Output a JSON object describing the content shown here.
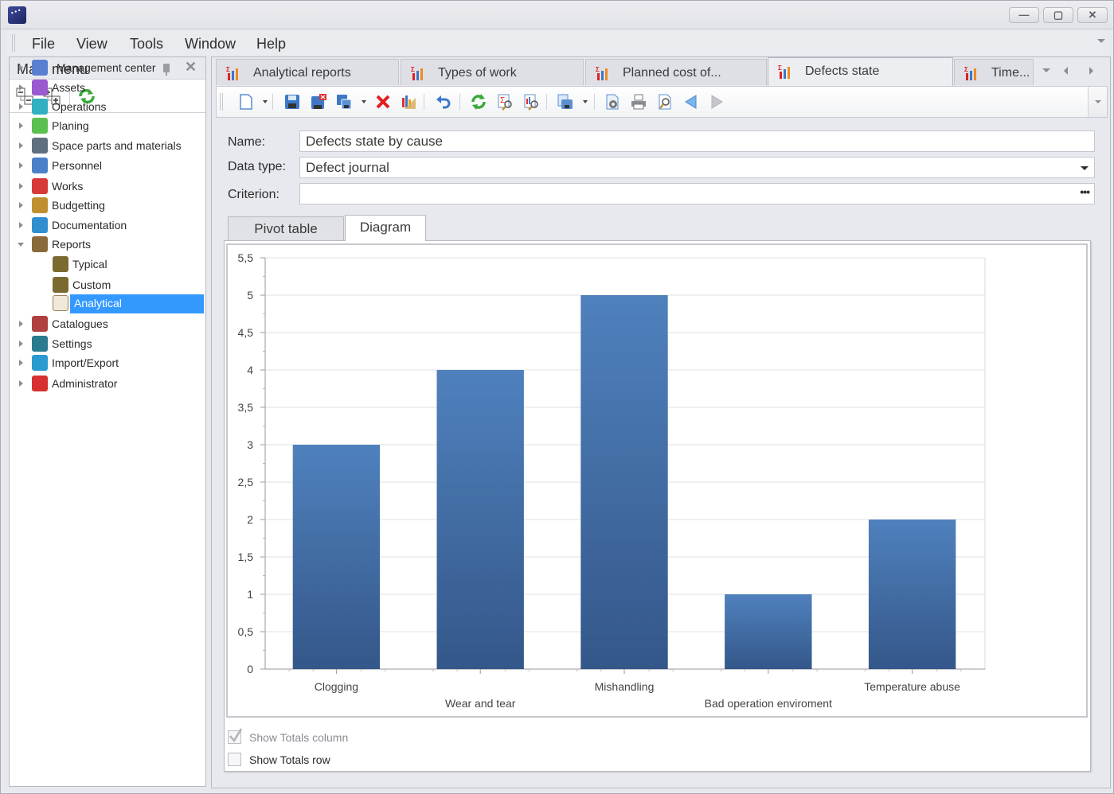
{
  "window": {
    "controls": {
      "minimize": "—",
      "maximize": "▢",
      "close": "✕"
    }
  },
  "menubar": {
    "items": [
      "File",
      "View",
      "Tools",
      "Window",
      "Help"
    ]
  },
  "sidebar": {
    "title": "Main menu",
    "toolbar": [
      "collapse-all",
      "expand-all",
      "refresh"
    ],
    "tree": [
      {
        "label": "Management center",
        "icon": "monitor-gear-icon",
        "expanded": false,
        "level": 0
      },
      {
        "label": "Assets",
        "icon": "assets-icon",
        "expanded": false,
        "level": 0
      },
      {
        "label": "Operations",
        "icon": "operations-icon",
        "expanded": false,
        "level": 0
      },
      {
        "label": "Planing",
        "icon": "planning-chart-icon",
        "expanded": false,
        "level": 0
      },
      {
        "label": "Space parts and materials",
        "icon": "parts-icon",
        "expanded": false,
        "level": 0
      },
      {
        "label": "Personnel",
        "icon": "personnel-icon",
        "expanded": false,
        "level": 0
      },
      {
        "label": "Works",
        "icon": "works-icon",
        "expanded": false,
        "level": 0
      },
      {
        "label": "Budgetting",
        "icon": "scales-icon",
        "expanded": false,
        "level": 0
      },
      {
        "label": "Documentation",
        "icon": "notebook-icon",
        "expanded": false,
        "level": 0
      },
      {
        "label": "Reports",
        "icon": "clipboard-icon",
        "expanded": true,
        "level": 0
      },
      {
        "label": "Typical",
        "icon": "report-doc-icon",
        "level": 1
      },
      {
        "label": "Custom",
        "icon": "report-doc-icon",
        "level": 1
      },
      {
        "label": "Analytical",
        "icon": "analytics-doc-icon",
        "level": 1,
        "selected": true
      },
      {
        "label": "Catalogues",
        "icon": "books-icon",
        "expanded": false,
        "level": 0
      },
      {
        "label": "Settings",
        "icon": "settings-gear-icon",
        "expanded": false,
        "level": 0
      },
      {
        "label": "Import/Export",
        "icon": "import-export-icon",
        "expanded": false,
        "level": 0
      },
      {
        "label": "Administrator",
        "icon": "admin-user-icon",
        "expanded": false,
        "level": 0
      }
    ]
  },
  "doc_tabs": [
    {
      "label": "Analytical reports",
      "active": false
    },
    {
      "label": "Types of work",
      "active": false
    },
    {
      "label": "Planned cost of...",
      "active": false
    },
    {
      "label": "Defects state",
      "active": true
    },
    {
      "label": "Time...",
      "active": false
    }
  ],
  "toolbar": {
    "buttons": [
      "new",
      "save",
      "save-delete",
      "save-copy",
      "delete",
      "chart-settings",
      "undo",
      "refresh",
      "sum-search",
      "chart-search",
      "print-menu",
      "page-setup",
      "print",
      "print-preview",
      "back",
      "forward"
    ]
  },
  "form": {
    "name_label": "Name:",
    "name_value": "Defects state by cause",
    "datatype_label": "Data type:",
    "datatype_value": "Defect journal",
    "criterion_label": "Criterion:",
    "criterion_value": "",
    "criterion_button": "•••"
  },
  "view_tabs": [
    {
      "label": "Pivot table",
      "active": false
    },
    {
      "label": "Diagram",
      "active": true
    }
  ],
  "options": {
    "show_totals_column": {
      "label": "Show Totals column",
      "checked": true,
      "enabled": false
    },
    "show_totals_row": {
      "label": "Show Totals row",
      "checked": false,
      "enabled": true
    }
  },
  "colors": {
    "bar_top": "#4f81bd",
    "bar_bottom": "#34578a",
    "selection": "#3399ff",
    "accent_red": "#e02020"
  },
  "chart_data": {
    "type": "bar",
    "title": "",
    "xlabel": "",
    "ylabel": "",
    "categories": [
      "Clogging",
      "Wear and tear",
      "Mishandling",
      "Bad operation enviroment",
      "Temperature abuse"
    ],
    "values": [
      3,
      4,
      5,
      1,
      2
    ],
    "ylim": [
      0,
      5.5
    ],
    "yticks": [
      "0",
      "0,5",
      "1",
      "1,5",
      "2",
      "2,5",
      "3",
      "3,5",
      "4",
      "4,5",
      "5",
      "5,5"
    ],
    "grid": true,
    "legend": "none",
    "label_stagger": [
      0,
      1,
      0,
      1,
      0
    ]
  }
}
